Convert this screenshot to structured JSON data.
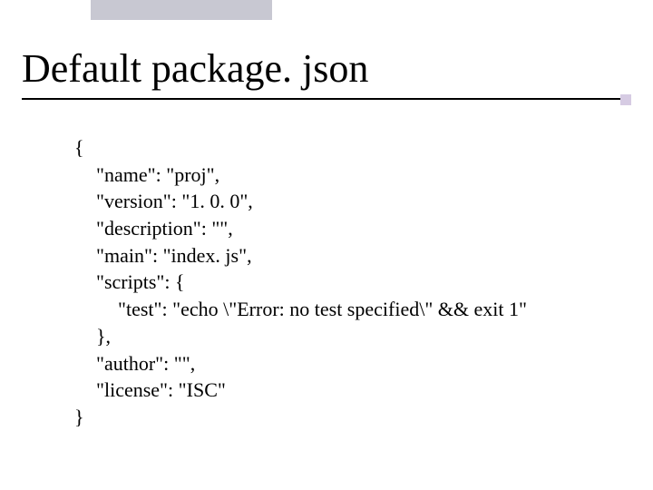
{
  "title": "Default package. json",
  "code": {
    "open": "{",
    "l1": "\"name\": \"proj\",",
    "l2": "\"version\": \"1. 0. 0\",",
    "l3": "\"description\": \"\",",
    "l4": "\"main\": \"index. js\",",
    "l5": "\"scripts\": {",
    "l6": "\"test\": \"echo \\\"Error: no test specified\\\" && exit 1\"",
    "l7": "},",
    "l8": "\"author\": \"\",",
    "l9": "\"license\": \"ISC\"",
    "close": "}"
  }
}
